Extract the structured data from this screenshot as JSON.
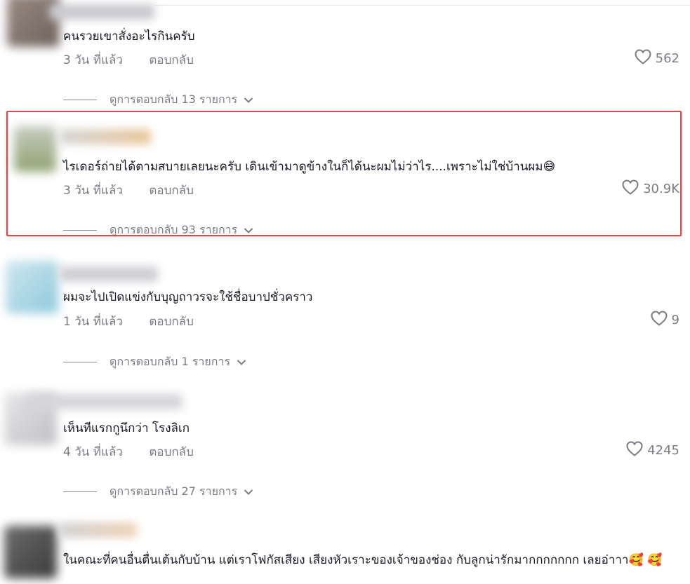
{
  "comments": [
    {
      "text": "คนรวยเขาสั่งอะไรกินครับ",
      "time": "3 วัน ที่แล้ว",
      "reply_label": "ตอบกลับ",
      "likes": "562",
      "view_replies": "ดูการตอบกลับ 13 รายการ"
    },
    {
      "text": "ไรเดอร์ถ่ายได้ตามสบายเลยนะครับ เดินเข้ามาดูข้างในก็ได้นะผมไม่ว่าไร....เพราะไม่ใช่บ้านผม😅",
      "time": "3 วัน ที่แล้ว",
      "reply_label": "ตอบกลับ",
      "likes": "30.9K",
      "view_replies": "ดูการตอบกลับ 93 รายการ"
    },
    {
      "text": "ผมจะไปเปิดแข่งกับบุญถาวรจะใช้ชื่อบาปชั่วคราว",
      "time": "1 วัน ที่แล้ว",
      "reply_label": "ตอบกลับ",
      "likes": "9",
      "view_replies": "ดูการตอบกลับ 1 รายการ"
    },
    {
      "text": "เห็นทีแรกกูนึกว่า โรงลิเก",
      "time": "4 วัน ที่แล้ว",
      "reply_label": "ตอบกลับ",
      "likes": "4245",
      "view_replies": "ดูการตอบกลับ 27 รายการ"
    },
    {
      "text": "ในคณะที่คนอื่นตื่นเต้นกับบ้าน แต่เราโฟกัสเสียง เสียงหัวเราะของเจ้าของช่อง กับลูกน่ารักมากกกกกกก เลยอ่าาา🥰 🥰"
    }
  ],
  "colors": {
    "text": "#161823",
    "secondary": "#7a7c84",
    "highlight_border": "#e04848"
  },
  "icons": {
    "like": "heart-outline-icon",
    "expand": "chevron-down-icon"
  }
}
